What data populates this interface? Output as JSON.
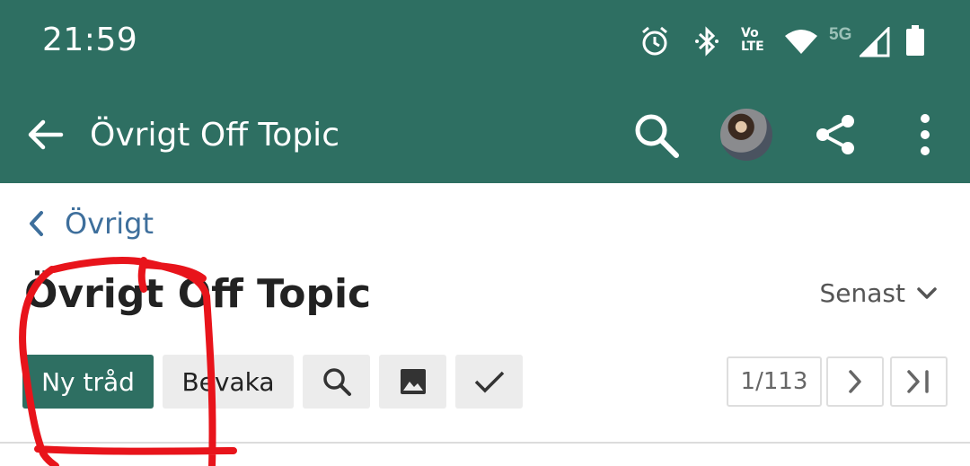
{
  "status_bar": {
    "time": "21:59",
    "network_label": "5G",
    "volte_label_top": "Vo",
    "volte_label_bottom": "LTE"
  },
  "app_bar": {
    "title": "Övrigt Off Topic",
    "color": "#2e6f62"
  },
  "breadcrumb": {
    "label": "Övrigt",
    "color": "#3e6f9c"
  },
  "page": {
    "title": "Övrigt Off Topic",
    "sort_label": "Senast"
  },
  "toolbar": {
    "new_thread_label": "Ny tråd",
    "watch_label": "Bevaka"
  },
  "pagination": {
    "page_indicator": "1/113"
  },
  "icons": [
    "back-arrow-icon",
    "search-icon",
    "share-icon",
    "more-vert-icon",
    "image-icon",
    "checkmark-icon",
    "chevron-right-icon",
    "last-page-icon",
    "alarm-icon",
    "bluetooth-icon",
    "wifi-icon",
    "signal-icon",
    "battery-icon"
  ],
  "annotation_color": "#e8141b"
}
